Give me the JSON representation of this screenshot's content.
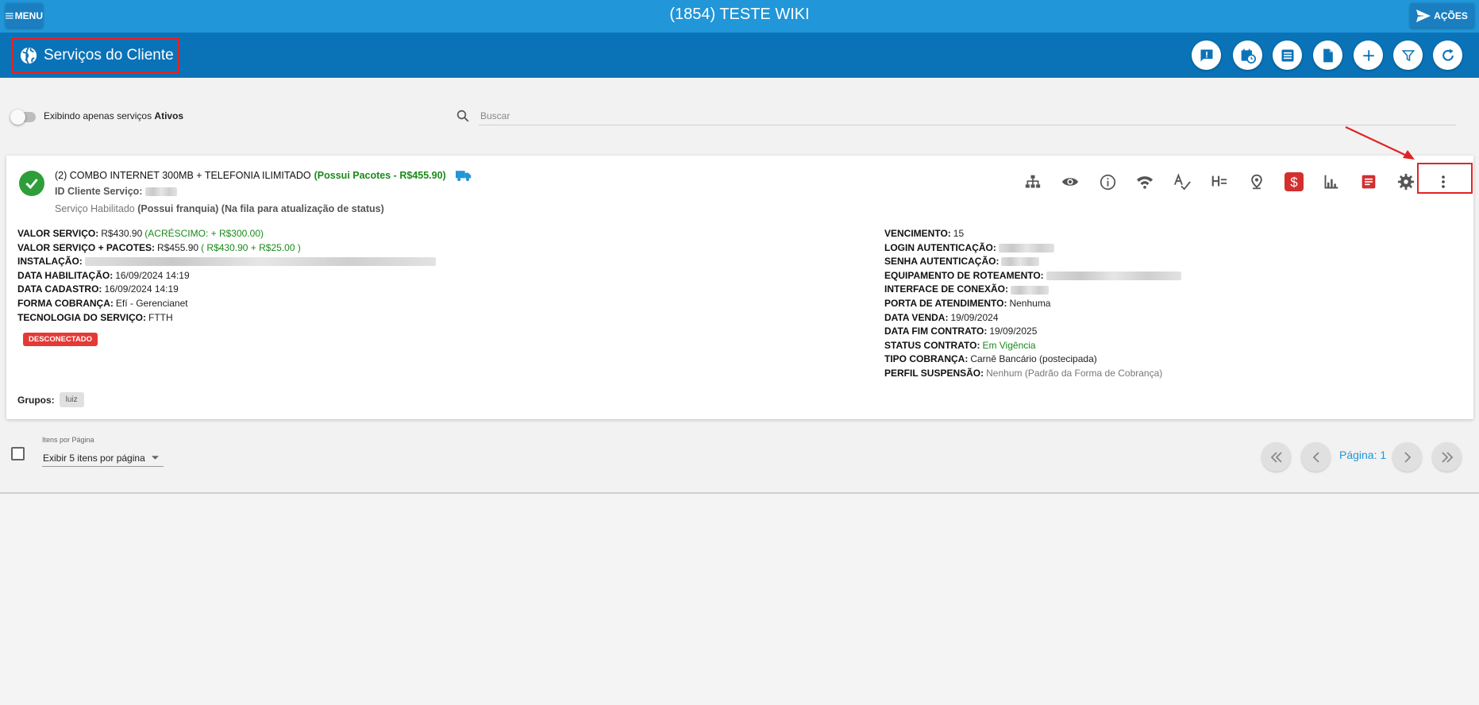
{
  "topbar": {
    "menu_label": "MENU",
    "title": "(1854) TESTE WIKI",
    "acoes_label": "AÇÕES"
  },
  "header": {
    "title": "Serviços do Cliente"
  },
  "filter": {
    "toggle_label_prefix": "Exibindo apenas serviços ",
    "toggle_label_bold": "Ativos",
    "search_placeholder": "Buscar"
  },
  "service": {
    "title": "(2) COMBO INTERNET 300MB + TELEFONIA ILIMITADO",
    "packages": "(Possui Pacotes - R$455.90)",
    "id_label": "ID Cliente Serviço:",
    "status_prefix": "Serviço Habilitado",
    "status_bold": "(Possui franquia) (Na fila para atualização de status)",
    "badge": "DESCONECTADO",
    "groups_label": "Grupos:",
    "group_chip": "luiz",
    "left": {
      "valor_label": "VALOR SERVIÇO:",
      "valor": "R$430.90",
      "valor_extra": "(ACRÉSCIMO: + R$300.00)",
      "pacotes_label": "VALOR SERVIÇO + PACOTES:",
      "pacotes": "R$455.90",
      "pacotes_extra": "( R$430.90 + R$25.00 )",
      "instalacao_label": "INSTALAÇÃO:",
      "habilitacao_label": "DATA HABILITAÇÃO:",
      "habilitacao": "16/09/2024 14:19",
      "cadastro_label": "DATA CADASTRO:",
      "cadastro": "16/09/2024 14:19",
      "cobranca_label": "FORMA COBRANÇA:",
      "cobranca": "Efí - Gerencianet",
      "tecnologia_label": "TECNOLOGIA DO SERVIÇO:",
      "tecnologia": "FTTH"
    },
    "right": {
      "vencimento_label": "VENCIMENTO:",
      "vencimento": "15",
      "login_label": "LOGIN AUTENTICAÇÃO:",
      "senha_label": "SENHA AUTENTICAÇÃO:",
      "equipamento_label": "EQUIPAMENTO DE ROTEAMENTO:",
      "interface_label": "INTERFACE DE CONEXÃO:",
      "porta_label": "PORTA DE ATENDIMENTO:",
      "porta": "Nenhuma",
      "venda_label": "DATA VENDA:",
      "venda": "19/09/2024",
      "fim_label": "DATA FIM CONTRATO:",
      "fim": "19/09/2025",
      "status_label": "STATUS CONTRATO:",
      "status": "Em Vigência",
      "tipo_label": "TIPO COBRANÇA:",
      "tipo": "Carnê Bancário (postecipada)",
      "perfil_label": "PERFIL SUSPENSÃO:",
      "perfil": "Nenhum (Padrão da Forma de Cobrança)"
    }
  },
  "footer": {
    "ipp_label": "Itens por Página",
    "ipp_value": "Exibir 5 itens por página",
    "page_label": "Página: 1"
  },
  "colors": {
    "topbar": "#2196d8",
    "subheader": "#0a73b8",
    "highlight": "#e02424",
    "success": "#2e9e3b",
    "danger": "#e53935"
  }
}
